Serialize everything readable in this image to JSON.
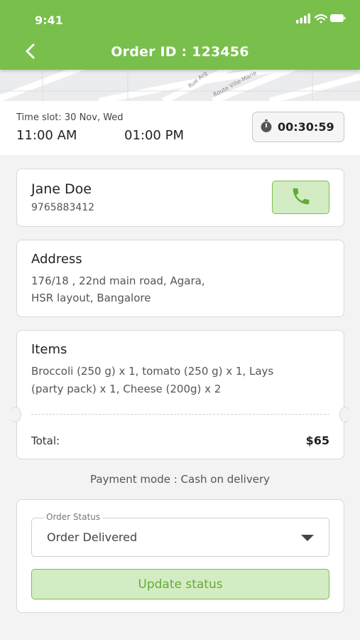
{
  "status_bar": {
    "time": "9:41"
  },
  "header": {
    "title": "Order ID : 123456",
    "color": "#78bf4b"
  },
  "map": {
    "street_1": "Rue Arg",
    "street_2": "Route Ville-Marie"
  },
  "timeslot": {
    "label": "Time slot: 30 Nov, Wed",
    "start": "11:00 AM",
    "end": "01:00 PM",
    "timer": "00:30:59"
  },
  "customer": {
    "name": "Jane Doe",
    "phone": "9765883412"
  },
  "address": {
    "title": "Address",
    "line1": "176/18 , 22nd main road, Agara,",
    "line2": "HSR layout, Bangalore"
  },
  "items": {
    "title": "Items",
    "line1": "Broccoli (250 g) x 1, tomato (250 g) x 1, Lays",
    "line2": "(party pack) x 1, Cheese (200g) x 2",
    "total_label": "Total:",
    "total_value": "$65"
  },
  "payment": {
    "text": "Payment mode : Cash on delivery"
  },
  "order_status": {
    "legend": "Order Status",
    "selected": "Order Delivered",
    "button_label": "Update status"
  },
  "icons": {
    "back": "back-arrow-icon",
    "timer": "stopwatch-icon",
    "call": "phone-icon",
    "dropdown": "caret-down-icon"
  }
}
